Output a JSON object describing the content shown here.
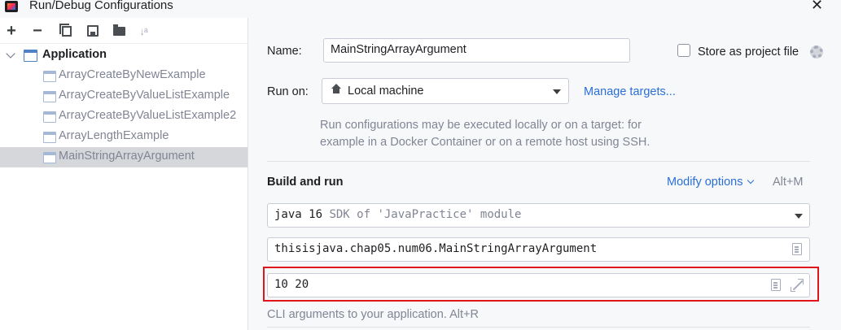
{
  "window": {
    "title": "Run/Debug Configurations",
    "close_icon": "close-icon",
    "app_icon": "intellij-icon"
  },
  "toolbar": {
    "add": "+",
    "remove": "−",
    "sort": "↓ᵃ"
  },
  "tree": {
    "root": {
      "label": "Application",
      "expanded": true
    },
    "items": [
      {
        "label": "ArrayCreateByNewExample",
        "selected": false
      },
      {
        "label": "ArrayCreateByValueListExample",
        "selected": false
      },
      {
        "label": "ArrayCreateByValueListExample2",
        "selected": false
      },
      {
        "label": "ArrayLengthExample",
        "selected": false
      },
      {
        "label": "MainStringArrayArgument",
        "selected": true
      }
    ]
  },
  "form": {
    "name_label": "Name:",
    "name_value": "MainStringArrayArgument",
    "store_label": "Store as project file",
    "store_checked": false,
    "run_on_label": "Run on:",
    "run_on_value": "Local machine",
    "manage_targets": "Manage targets...",
    "hint_line1": "Run configurations may be executed locally or on a target: for",
    "hint_line2": "example in a Docker Container or on a remote host using SSH.",
    "build_run_title": "Build and run",
    "modify_options": "Modify options",
    "modify_shortcut": "Alt+M",
    "sdk_main": "java 16",
    "sdk_detail": "SDK of 'JavaPractice' module",
    "main_class": "thisisjava.chap05.num06.MainStringArrayArgument",
    "program_args": "10 20",
    "args_hint": "CLI arguments to your application. Alt+R"
  },
  "colors": {
    "accent_link": "#2a6fd6",
    "highlight_border": "#e0151b",
    "selected_row": "#d5d7db"
  }
}
